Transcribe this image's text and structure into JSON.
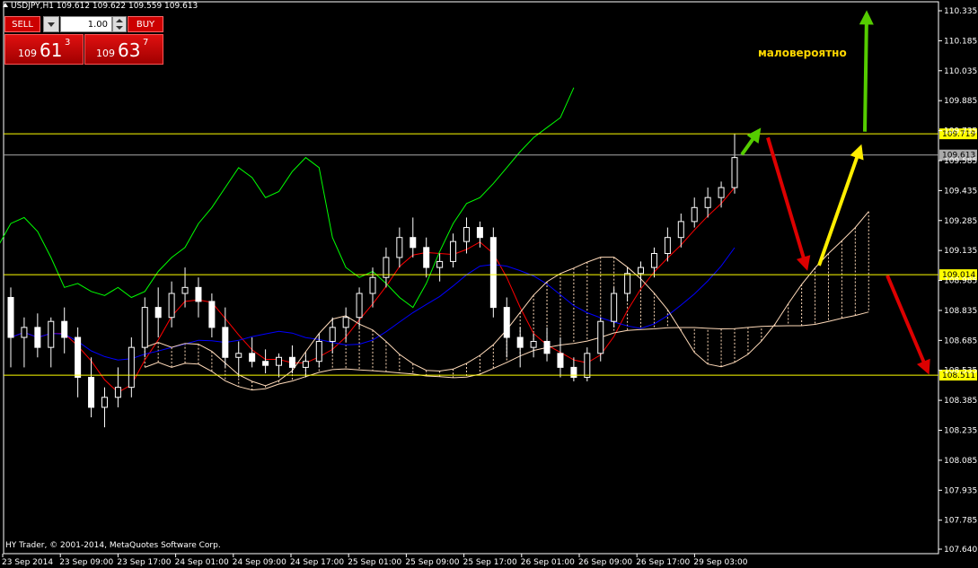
{
  "window": {
    "symbol_header": "USDJPY,H1  109.612 109.622 109.559 109.613",
    "copyright": "HY Trader, © 2001-2014, MetaQuotes Software Corp."
  },
  "trade_panel": {
    "sell_label": "SELL",
    "buy_label": "BUY",
    "lot_value": "1.00",
    "sell_price": {
      "prefix": "109",
      "big": "61",
      "sup": "3"
    },
    "buy_price": {
      "prefix": "109",
      "big": "63",
      "sup": "7"
    }
  },
  "annotation": {
    "text": "маловероятно",
    "color": "#ffd700"
  },
  "colors": {
    "background": "#000000",
    "candle": "#ffffff",
    "tenkan": "#ff0000",
    "kijun": "#0000ff",
    "chikou": "#00ff00",
    "cloud": "#ffdab9",
    "level_line": "#ffff00",
    "arrow_green": "#55cc00",
    "arrow_red": "#dd0000",
    "arrow_yellow": "#ffee00"
  },
  "chart_data": {
    "type": "candlestick",
    "y_axis_ticks": [
      "110.335",
      "110.185",
      "110.035",
      "109.885",
      "109.735",
      "109.585",
      "109.435",
      "109.285",
      "109.135",
      "108.985",
      "108.835",
      "108.685",
      "108.535",
      "108.385",
      "108.235",
      "108.085",
      "107.935",
      "107.785",
      "107.640"
    ],
    "x_axis_ticks": [
      "23 Sep 2014",
      "23 Sep 09:00",
      "23 Sep 17:00",
      "24 Sep 01:00",
      "24 Sep 09:00",
      "24 Sep 17:00",
      "25 Sep 01:00",
      "25 Sep 09:00",
      "25 Sep 17:00",
      "26 Sep 01:00",
      "26 Sep 09:00",
      "26 Sep 17:00",
      "29 Sep 03:00"
    ],
    "ylim": [
      107.64,
      110.37
    ],
    "levels": [
      {
        "label": "109.719",
        "value": 109.719,
        "color": "#ffff00"
      },
      {
        "label": "109.613",
        "value": 109.613,
        "color": "#aaaaaa"
      },
      {
        "label": "109.014",
        "value": 109.014,
        "color": "#ffff00"
      },
      {
        "label": "108.511",
        "value": 108.511,
        "color": "#ffff00"
      }
    ],
    "candles": [
      [
        108.9,
        108.95,
        108.55,
        108.7
      ],
      [
        108.7,
        108.8,
        108.55,
        108.75
      ],
      [
        108.75,
        108.82,
        108.6,
        108.65
      ],
      [
        108.65,
        108.8,
        108.55,
        108.78
      ],
      [
        108.78,
        108.85,
        108.62,
        108.7
      ],
      [
        108.7,
        108.75,
        108.4,
        108.5
      ],
      [
        108.5,
        108.6,
        108.3,
        108.35
      ],
      [
        108.35,
        108.45,
        108.25,
        108.4
      ],
      [
        108.4,
        108.55,
        108.35,
        108.45
      ],
      [
        108.45,
        108.7,
        108.4,
        108.65
      ],
      [
        108.65,
        108.9,
        108.6,
        108.85
      ],
      [
        108.85,
        108.95,
        108.7,
        108.8
      ],
      [
        108.8,
        108.98,
        108.75,
        108.92
      ],
      [
        108.92,
        109.05,
        108.85,
        108.95
      ],
      [
        108.95,
        109.0,
        108.8,
        108.88
      ],
      [
        108.88,
        108.92,
        108.7,
        108.75
      ],
      [
        108.75,
        108.85,
        108.55,
        108.6
      ],
      [
        108.6,
        108.68,
        108.5,
        108.62
      ],
      [
        108.62,
        108.7,
        108.55,
        108.58
      ],
      [
        108.58,
        108.64,
        108.52,
        108.56
      ],
      [
        108.56,
        108.62,
        108.5,
        108.6
      ],
      [
        108.6,
        108.66,
        108.52,
        108.55
      ],
      [
        108.55,
        108.62,
        108.5,
        108.58
      ],
      [
        108.58,
        108.72,
        108.55,
        108.68
      ],
      [
        108.68,
        108.8,
        108.62,
        108.75
      ],
      [
        108.75,
        108.85,
        108.68,
        108.8
      ],
      [
        108.8,
        108.95,
        108.75,
        108.92
      ],
      [
        108.92,
        109.05,
        108.85,
        109.0
      ],
      [
        109.0,
        109.15,
        108.95,
        109.1
      ],
      [
        109.1,
        109.25,
        109.05,
        109.2
      ],
      [
        109.2,
        109.3,
        109.1,
        109.15
      ],
      [
        109.15,
        109.2,
        109.0,
        109.05
      ],
      [
        109.05,
        109.12,
        108.98,
        109.08
      ],
      [
        109.08,
        109.22,
        109.05,
        109.18
      ],
      [
        109.18,
        109.3,
        109.12,
        109.25
      ],
      [
        109.25,
        109.28,
        109.15,
        109.2
      ],
      [
        109.2,
        109.25,
        108.8,
        108.85
      ],
      [
        108.85,
        108.9,
        108.6,
        108.7
      ],
      [
        108.7,
        108.75,
        108.55,
        108.65
      ],
      [
        108.65,
        108.72,
        108.6,
        108.68
      ],
      [
        108.68,
        108.75,
        108.58,
        108.62
      ],
      [
        108.62,
        108.7,
        108.5,
        108.55
      ],
      [
        108.55,
        108.6,
        108.48,
        108.5
      ],
      [
        108.5,
        108.65,
        108.48,
        108.62
      ],
      [
        108.62,
        108.8,
        108.58,
        108.78
      ],
      [
        108.78,
        108.95,
        108.75,
        108.92
      ],
      [
        108.92,
        109.05,
        108.88,
        109.02
      ],
      [
        109.02,
        109.08,
        108.95,
        109.05
      ],
      [
        109.05,
        109.15,
        109.0,
        109.12
      ],
      [
        109.12,
        109.25,
        109.08,
        109.2
      ],
      [
        109.2,
        109.32,
        109.15,
        109.28
      ],
      [
        109.28,
        109.4,
        109.25,
        109.35
      ],
      [
        109.35,
        109.45,
        109.3,
        109.4
      ],
      [
        109.4,
        109.48,
        109.35,
        109.45
      ],
      [
        109.45,
        109.72,
        109.42,
        109.6
      ]
    ]
  }
}
